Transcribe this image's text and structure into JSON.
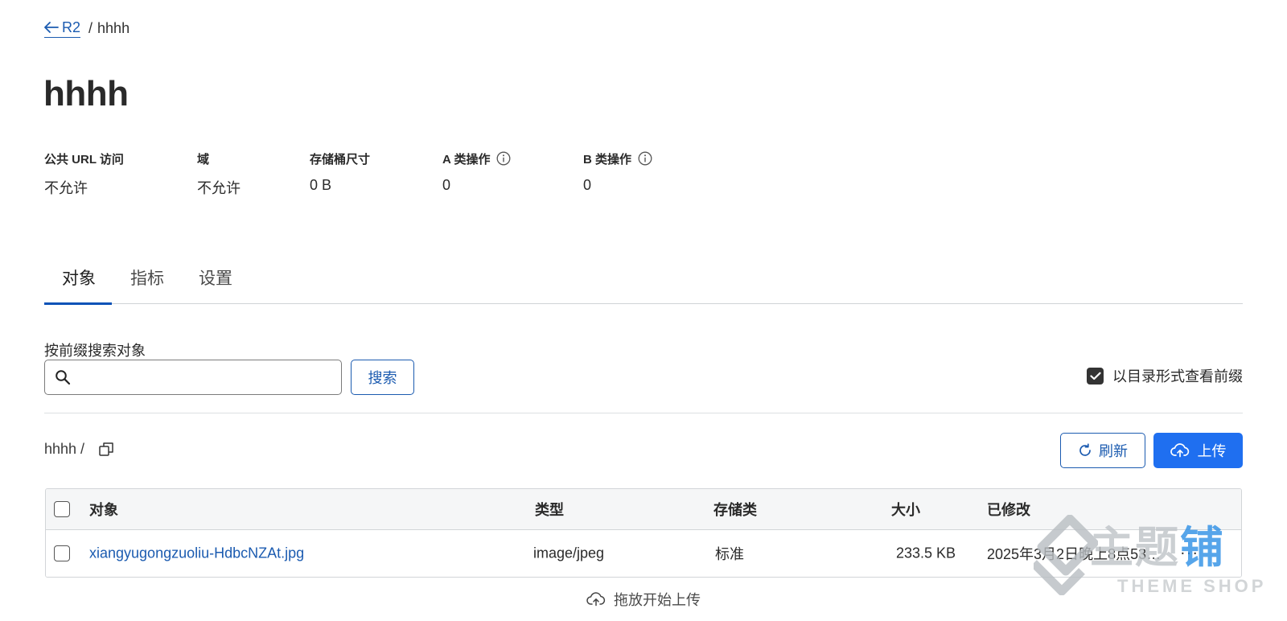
{
  "breadcrumb": {
    "root": "R2",
    "separator": "/",
    "current": "hhhh"
  },
  "page_title": "hhhh",
  "stats": [
    {
      "label": "公共 URL 访问",
      "value": "不允许",
      "info": false
    },
    {
      "label": "域",
      "value": "不允许",
      "info": false
    },
    {
      "label": "存储桶尺寸",
      "value": "0 B",
      "info": false
    },
    {
      "label": "A 类操作",
      "value": "0",
      "info": true
    },
    {
      "label": "B 类操作",
      "value": "0",
      "info": true
    }
  ],
  "tabs": [
    {
      "label": "对象",
      "active": true
    },
    {
      "label": "指标",
      "active": false
    },
    {
      "label": "设置",
      "active": false
    }
  ],
  "search": {
    "label": "按前缀搜索对象",
    "value": "",
    "placeholder": "",
    "button": "搜索"
  },
  "directory_toggle": {
    "label": "以目录形式查看前缀",
    "checked": true
  },
  "path": {
    "text": "hhhh /"
  },
  "actions": {
    "refresh": "刷新",
    "upload": "上传"
  },
  "table": {
    "columns": [
      "对象",
      "类型",
      "存储类",
      "大小",
      "已修改"
    ],
    "rows": [
      {
        "name": "xiangyugongzuoliu-HdbcNZAt.jpg",
        "type": "image/jpeg",
        "storage_class": "标准",
        "size": "233.5 KB",
        "modified": "2025年3月2日晚上8点53…",
        "more": "···"
      }
    ]
  },
  "dropzone": {
    "label": "拖放开始上传"
  },
  "watermark": {
    "main_gray": "主题",
    "main_blue": "铺",
    "sub": "THEME SHOP"
  },
  "colors": {
    "accent": "#1b5bb0",
    "primary_button": "#1f6ff0",
    "tab_active": "#0a52b7",
    "border": "#d2d5d8"
  }
}
